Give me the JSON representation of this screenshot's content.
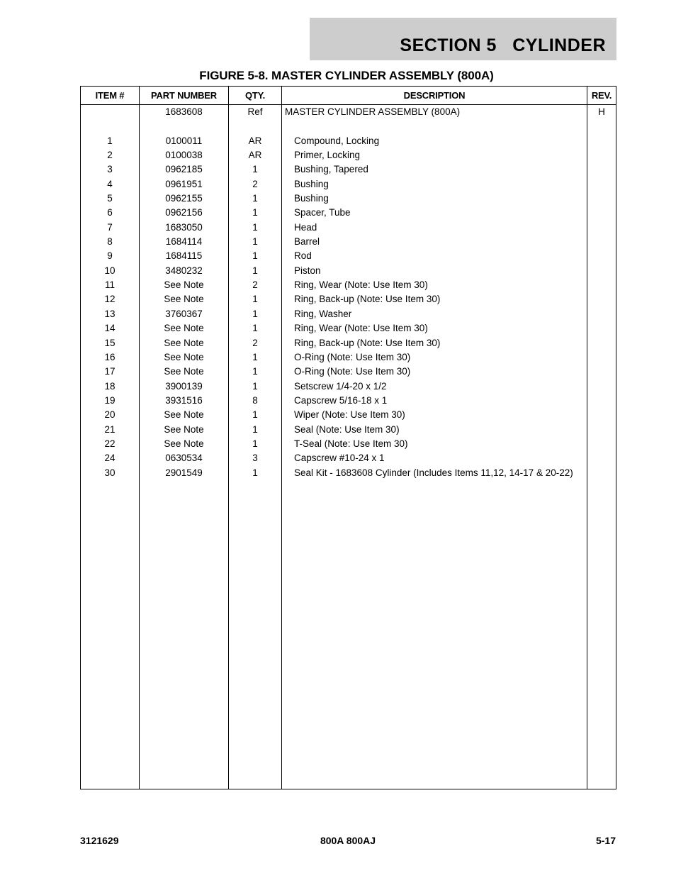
{
  "header": {
    "section_label": "SECTION 5   CYLINDER"
  },
  "figure": {
    "title": "FIGURE 5-8.  MASTER CYLINDER ASSEMBLY (800A)"
  },
  "table": {
    "columns": [
      "ITEM #",
      "PART NUMBER",
      "QTY.",
      "DESCRIPTION",
      "REV."
    ],
    "rows": [
      {
        "item": "",
        "part": "1683608",
        "qty": "Ref",
        "desc": "MASTER CYLINDER ASSEMBLY (800A)",
        "rev": "H"
      },
      {
        "item": "1",
        "part": "0100011",
        "qty": "AR",
        "desc": "Compound, Locking",
        "rev": ""
      },
      {
        "item": "2",
        "part": "0100038",
        "qty": "AR",
        "desc": "Primer, Locking",
        "rev": ""
      },
      {
        "item": "3",
        "part": "0962185",
        "qty": "1",
        "desc": "Bushing, Tapered",
        "rev": ""
      },
      {
        "item": "4",
        "part": "0961951",
        "qty": "2",
        "desc": "Bushing",
        "rev": ""
      },
      {
        "item": "5",
        "part": "0962155",
        "qty": "1",
        "desc": "Bushing",
        "rev": ""
      },
      {
        "item": "6",
        "part": "0962156",
        "qty": "1",
        "desc": "Spacer, Tube",
        "rev": ""
      },
      {
        "item": "7",
        "part": "1683050",
        "qty": "1",
        "desc": "Head",
        "rev": ""
      },
      {
        "item": "8",
        "part": "1684114",
        "qty": "1",
        "desc": "Barrel",
        "rev": ""
      },
      {
        "item": "9",
        "part": "1684115",
        "qty": "1",
        "desc": "Rod",
        "rev": ""
      },
      {
        "item": "10",
        "part": "3480232",
        "qty": "1",
        "desc": "Piston",
        "rev": ""
      },
      {
        "item": "11",
        "part": "See Note",
        "qty": "2",
        "desc": "Ring, Wear (Note: Use Item 30)",
        "rev": ""
      },
      {
        "item": "12",
        "part": "See Note",
        "qty": "1",
        "desc": "Ring, Back-up (Note: Use Item 30)",
        "rev": ""
      },
      {
        "item": "13",
        "part": "3760367",
        "qty": "1",
        "desc": "Ring, Washer",
        "rev": ""
      },
      {
        "item": "14",
        "part": "See Note",
        "qty": "1",
        "desc": "Ring, Wear (Note: Use Item 30)",
        "rev": ""
      },
      {
        "item": "15",
        "part": "See Note",
        "qty": "2",
        "desc": "Ring, Back-up (Note: Use Item 30)",
        "rev": ""
      },
      {
        "item": "16",
        "part": "See Note",
        "qty": "1",
        "desc": "O-Ring (Note: Use Item 30)",
        "rev": ""
      },
      {
        "item": "17",
        "part": "See Note",
        "qty": "1",
        "desc": "O-Ring (Note: Use Item 30)",
        "rev": ""
      },
      {
        "item": "18",
        "part": "3900139",
        "qty": "1",
        "desc": "Setscrew 1/4-20 x 1/2",
        "rev": ""
      },
      {
        "item": "19",
        "part": "3931516",
        "qty": "8",
        "desc": "Capscrew 5/16-18 x 1",
        "rev": ""
      },
      {
        "item": "20",
        "part": "See Note",
        "qty": "1",
        "desc": "Wiper (Note: Use Item 30)",
        "rev": ""
      },
      {
        "item": "21",
        "part": "See Note",
        "qty": "1",
        "desc": "Seal (Note: Use Item 30)",
        "rev": ""
      },
      {
        "item": "22",
        "part": "See Note",
        "qty": "1",
        "desc": "T-Seal (Note: Use Item 30)",
        "rev": ""
      },
      {
        "item": "24",
        "part": "0630534",
        "qty": "3",
        "desc": "Capscrew #10-24 x 1",
        "rev": ""
      },
      {
        "item": "30",
        "part": "2901549",
        "qty": "1",
        "desc": "Seal Kit - 1683608 Cylinder (Includes Items 11,12, 14-17 & 20-22)",
        "rev": ""
      }
    ]
  },
  "footer": {
    "document_number": "3121629",
    "model": "800A 800AJ",
    "page_number": "5-17"
  }
}
